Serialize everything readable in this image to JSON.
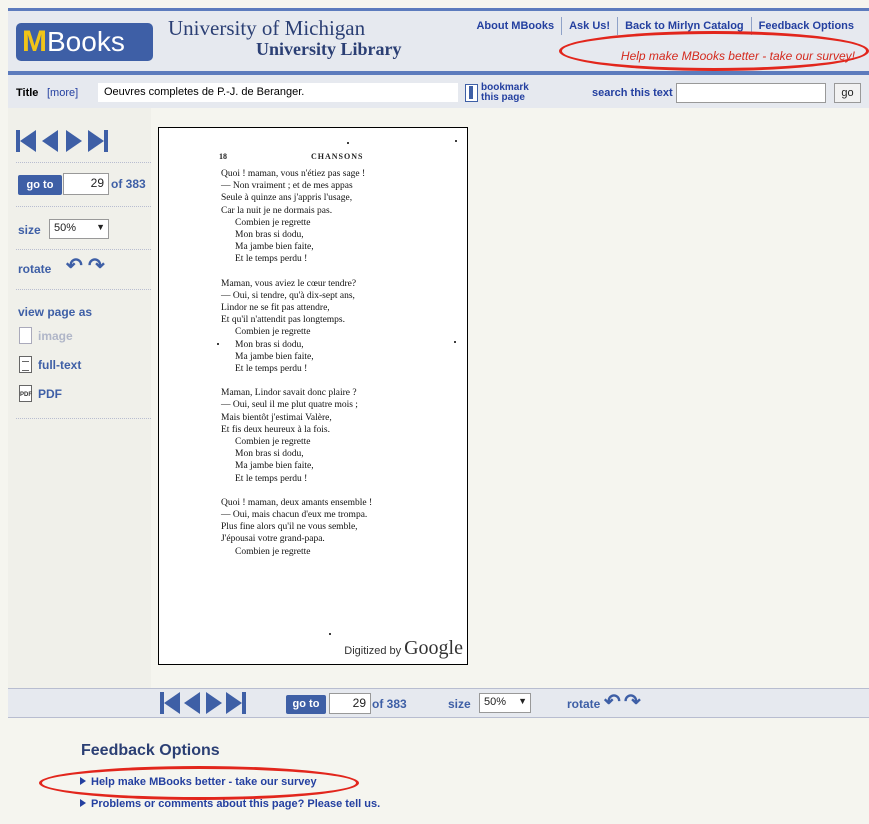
{
  "header": {
    "logo_m": "M",
    "logo_books": "Books",
    "university_line1": "University of Michigan",
    "university_line2": "University Library",
    "nav": [
      "About MBooks",
      "Ask Us!",
      "Back to Mirlyn Catalog",
      "Feedback Options"
    ],
    "survey_text": "Help make MBooks better - take our survey!"
  },
  "titlebar": {
    "label": "Title",
    "more": "[more]",
    "title": "Oeuvres completes de P.-J. de Beranger.",
    "bookmark_line1": "bookmark",
    "bookmark_line2": "this page",
    "search_label": "search this text",
    "search_value": "",
    "search_go": "go"
  },
  "sidebar": {
    "goto_label": "go to",
    "page_value": "29",
    "of_text": "of 383",
    "size_label": "size",
    "size_value": "50%",
    "rotate_label": "rotate",
    "view_as_label": "view page as",
    "view_options": [
      "image",
      "full-text",
      "PDF"
    ],
    "pdf_badge": "PDF"
  },
  "page": {
    "page_number": "18",
    "running_head": "CHANSONS",
    "lines": [
      "Quoi ! maman, vous n'étiez pas sage !",
      "— Non vraiment ; et de mes appas",
      "Seule à quinze ans j'appris l'usage,",
      "Car la nuit je ne dormais pas.",
      "Combien je regrette",
      "Mon bras si dodu,",
      "Ma jambe bien faite,",
      "Et le temps perdu !",
      "",
      "Maman, vous aviez le cœur tendre?",
      "— Oui, si tendre, qu'à dix-sept ans,",
      "Lindor ne se fit pas attendre,",
      "Et qu'il n'attendit pas longtemps.",
      "Combien je regrette",
      "Mon bras si dodu,",
      "Ma jambe bien faite,",
      "Et le temps perdu !",
      "",
      "Maman, Lindor savait donc plaire ?",
      "— Oui, seul il me plut quatre mois ;",
      "Mais bientôt j'estimai Valère,",
      "Et fis deux heureux à la fois.",
      "Combien je regrette",
      "Mon bras si dodu,",
      "Ma jambe bien faite,",
      "Et le temps perdu !",
      "",
      "Quoi ! maman, deux amants ensemble !",
      "— Oui, mais chacun d'eux me trompa.",
      "Plus fine alors qu'il ne vous semble,",
      "J'épousai votre grand-papa.",
      "Combien je regrette"
    ],
    "indented": [
      4,
      5,
      6,
      7,
      13,
      14,
      15,
      16,
      22,
      23,
      24,
      25,
      31
    ],
    "digitized_by": "Digitized by",
    "google": "Google"
  },
  "bottombar": {
    "goto_label": "go to",
    "page_value": "29",
    "of_text": "of 383",
    "size_label": "size",
    "size_value": "50%",
    "rotate_label": "rotate"
  },
  "feedback": {
    "title": "Feedback Options",
    "links": [
      "Help make MBooks better - take our survey",
      "Problems or comments about this page?  Please tell us."
    ]
  },
  "colors": {
    "accent": "#3e5fa6",
    "link": "#2440a0",
    "annotation_red": "#e2261c"
  }
}
